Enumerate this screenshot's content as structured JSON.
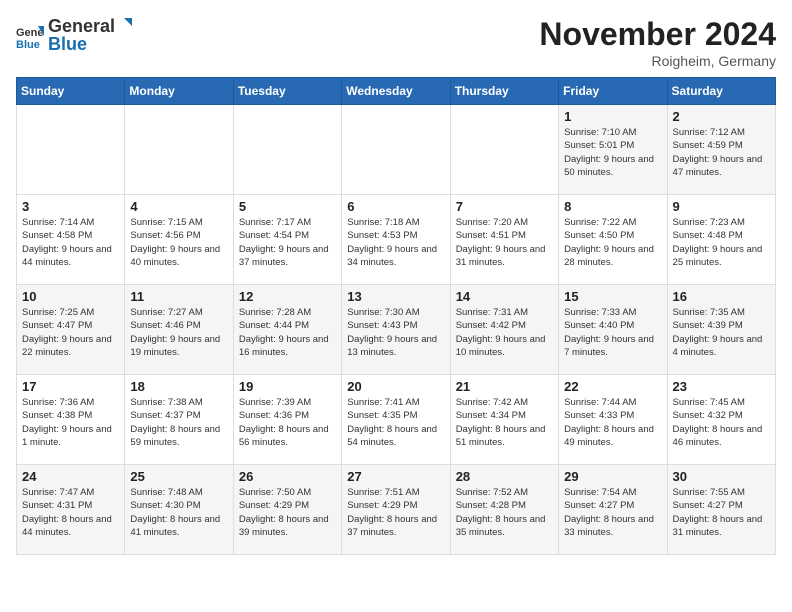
{
  "logo": {
    "general": "General",
    "blue": "Blue"
  },
  "title": "November 2024",
  "location": "Roigheim, Germany",
  "days_of_week": [
    "Sunday",
    "Monday",
    "Tuesday",
    "Wednesday",
    "Thursday",
    "Friday",
    "Saturday"
  ],
  "weeks": [
    [
      {
        "day": "",
        "info": ""
      },
      {
        "day": "",
        "info": ""
      },
      {
        "day": "",
        "info": ""
      },
      {
        "day": "",
        "info": ""
      },
      {
        "day": "",
        "info": ""
      },
      {
        "day": "1",
        "info": "Sunrise: 7:10 AM\nSunset: 5:01 PM\nDaylight: 9 hours and 50 minutes."
      },
      {
        "day": "2",
        "info": "Sunrise: 7:12 AM\nSunset: 4:59 PM\nDaylight: 9 hours and 47 minutes."
      }
    ],
    [
      {
        "day": "3",
        "info": "Sunrise: 7:14 AM\nSunset: 4:58 PM\nDaylight: 9 hours and 44 minutes."
      },
      {
        "day": "4",
        "info": "Sunrise: 7:15 AM\nSunset: 4:56 PM\nDaylight: 9 hours and 40 minutes."
      },
      {
        "day": "5",
        "info": "Sunrise: 7:17 AM\nSunset: 4:54 PM\nDaylight: 9 hours and 37 minutes."
      },
      {
        "day": "6",
        "info": "Sunrise: 7:18 AM\nSunset: 4:53 PM\nDaylight: 9 hours and 34 minutes."
      },
      {
        "day": "7",
        "info": "Sunrise: 7:20 AM\nSunset: 4:51 PM\nDaylight: 9 hours and 31 minutes."
      },
      {
        "day": "8",
        "info": "Sunrise: 7:22 AM\nSunset: 4:50 PM\nDaylight: 9 hours and 28 minutes."
      },
      {
        "day": "9",
        "info": "Sunrise: 7:23 AM\nSunset: 4:48 PM\nDaylight: 9 hours and 25 minutes."
      }
    ],
    [
      {
        "day": "10",
        "info": "Sunrise: 7:25 AM\nSunset: 4:47 PM\nDaylight: 9 hours and 22 minutes."
      },
      {
        "day": "11",
        "info": "Sunrise: 7:27 AM\nSunset: 4:46 PM\nDaylight: 9 hours and 19 minutes."
      },
      {
        "day": "12",
        "info": "Sunrise: 7:28 AM\nSunset: 4:44 PM\nDaylight: 9 hours and 16 minutes."
      },
      {
        "day": "13",
        "info": "Sunrise: 7:30 AM\nSunset: 4:43 PM\nDaylight: 9 hours and 13 minutes."
      },
      {
        "day": "14",
        "info": "Sunrise: 7:31 AM\nSunset: 4:42 PM\nDaylight: 9 hours and 10 minutes."
      },
      {
        "day": "15",
        "info": "Sunrise: 7:33 AM\nSunset: 4:40 PM\nDaylight: 9 hours and 7 minutes."
      },
      {
        "day": "16",
        "info": "Sunrise: 7:35 AM\nSunset: 4:39 PM\nDaylight: 9 hours and 4 minutes."
      }
    ],
    [
      {
        "day": "17",
        "info": "Sunrise: 7:36 AM\nSunset: 4:38 PM\nDaylight: 9 hours and 1 minute."
      },
      {
        "day": "18",
        "info": "Sunrise: 7:38 AM\nSunset: 4:37 PM\nDaylight: 8 hours and 59 minutes."
      },
      {
        "day": "19",
        "info": "Sunrise: 7:39 AM\nSunset: 4:36 PM\nDaylight: 8 hours and 56 minutes."
      },
      {
        "day": "20",
        "info": "Sunrise: 7:41 AM\nSunset: 4:35 PM\nDaylight: 8 hours and 54 minutes."
      },
      {
        "day": "21",
        "info": "Sunrise: 7:42 AM\nSunset: 4:34 PM\nDaylight: 8 hours and 51 minutes."
      },
      {
        "day": "22",
        "info": "Sunrise: 7:44 AM\nSunset: 4:33 PM\nDaylight: 8 hours and 49 minutes."
      },
      {
        "day": "23",
        "info": "Sunrise: 7:45 AM\nSunset: 4:32 PM\nDaylight: 8 hours and 46 minutes."
      }
    ],
    [
      {
        "day": "24",
        "info": "Sunrise: 7:47 AM\nSunset: 4:31 PM\nDaylight: 8 hours and 44 minutes."
      },
      {
        "day": "25",
        "info": "Sunrise: 7:48 AM\nSunset: 4:30 PM\nDaylight: 8 hours and 41 minutes."
      },
      {
        "day": "26",
        "info": "Sunrise: 7:50 AM\nSunset: 4:29 PM\nDaylight: 8 hours and 39 minutes."
      },
      {
        "day": "27",
        "info": "Sunrise: 7:51 AM\nSunset: 4:29 PM\nDaylight: 8 hours and 37 minutes."
      },
      {
        "day": "28",
        "info": "Sunrise: 7:52 AM\nSunset: 4:28 PM\nDaylight: 8 hours and 35 minutes."
      },
      {
        "day": "29",
        "info": "Sunrise: 7:54 AM\nSunset: 4:27 PM\nDaylight: 8 hours and 33 minutes."
      },
      {
        "day": "30",
        "info": "Sunrise: 7:55 AM\nSunset: 4:27 PM\nDaylight: 8 hours and 31 minutes."
      }
    ]
  ]
}
